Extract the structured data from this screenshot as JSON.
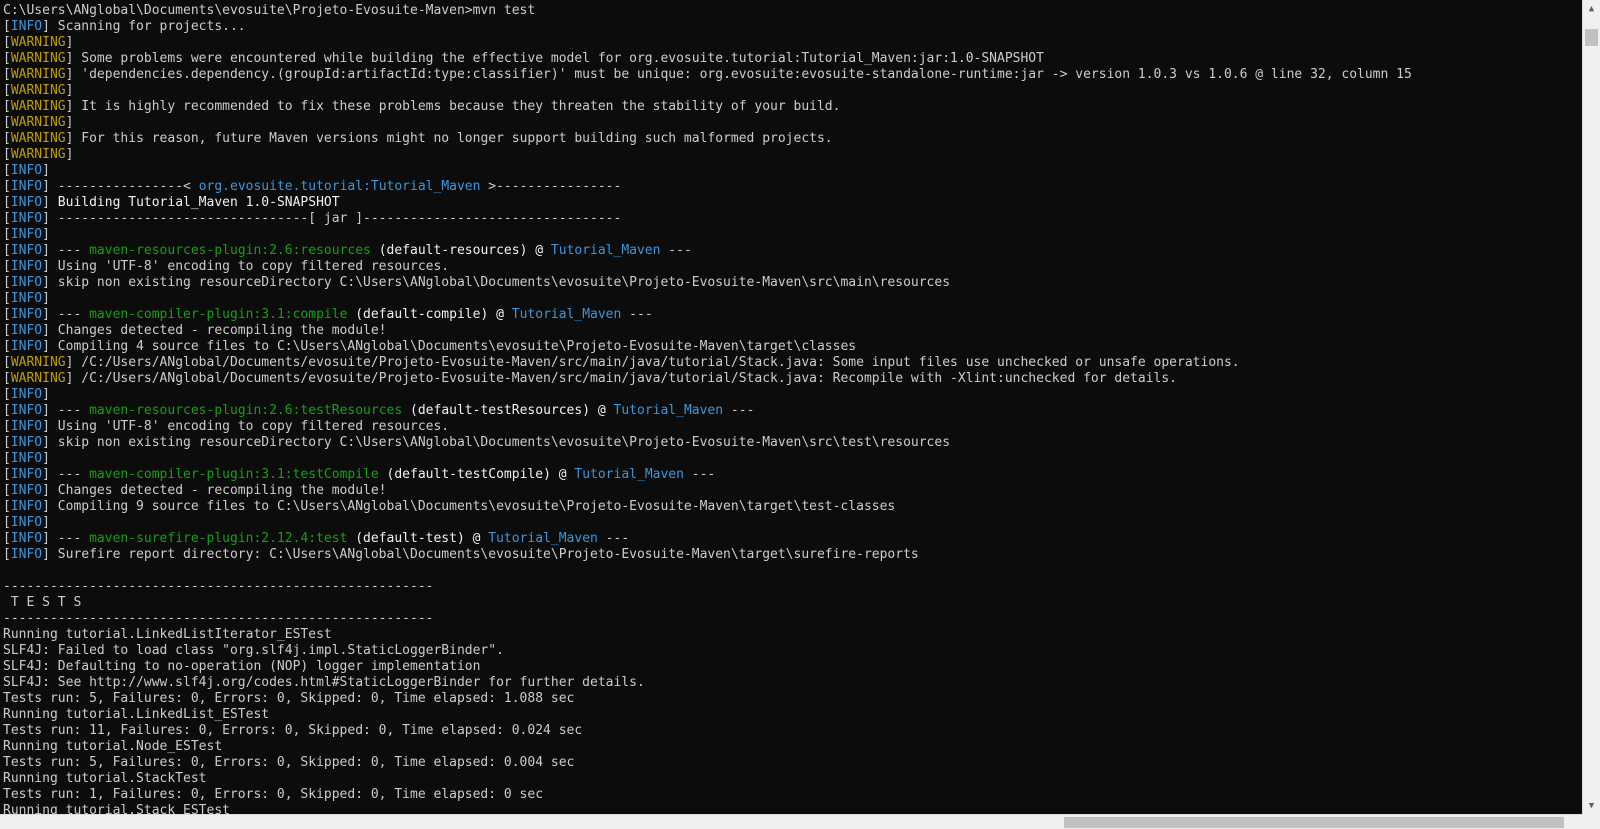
{
  "console": {
    "lines": [
      [
        [
          "C:\\Users\\ANglobal\\Documents\\evosuite\\Projeto-Evosuite-Maven>mvn test",
          "dim"
        ]
      ],
      [
        [
          "[",
          "bracket"
        ],
        [
          "INFO",
          "lvl-INFO"
        ],
        [
          "] Scanning for projects...",
          "dim"
        ]
      ],
      [
        [
          "[",
          "bracket"
        ],
        [
          "WARNING",
          "lvl-WARNING"
        ],
        [
          "]",
          "bracket"
        ]
      ],
      [
        [
          "[",
          "bracket"
        ],
        [
          "WARNING",
          "lvl-WARNING"
        ],
        [
          "] Some problems were encountered while building the effective model for org.evosuite.tutorial:Tutorial_Maven:jar:1.0-SNAPSHOT",
          "dim"
        ]
      ],
      [
        [
          "[",
          "bracket"
        ],
        [
          "WARNING",
          "lvl-WARNING"
        ],
        [
          "] 'dependencies.dependency.(groupId:artifactId:type:classifier)' must be unique: org.evosuite:evosuite-standalone-runtime:jar -> version 1.0.3 vs 1.0.6 @ line 32, column 15",
          "dim"
        ]
      ],
      [
        [
          "[",
          "bracket"
        ],
        [
          "WARNING",
          "lvl-WARNING"
        ],
        [
          "]",
          "bracket"
        ]
      ],
      [
        [
          "[",
          "bracket"
        ],
        [
          "WARNING",
          "lvl-WARNING"
        ],
        [
          "] It is highly recommended to fix these problems because they threaten the stability of your build.",
          "dim"
        ]
      ],
      [
        [
          "[",
          "bracket"
        ],
        [
          "WARNING",
          "lvl-WARNING"
        ],
        [
          "]",
          "bracket"
        ]
      ],
      [
        [
          "[",
          "bracket"
        ],
        [
          "WARNING",
          "lvl-WARNING"
        ],
        [
          "] For this reason, future Maven versions might no longer support building such malformed projects.",
          "dim"
        ]
      ],
      [
        [
          "[",
          "bracket"
        ],
        [
          "WARNING",
          "lvl-WARNING"
        ],
        [
          "]",
          "bracket"
        ]
      ],
      [
        [
          "[",
          "bracket"
        ],
        [
          "INFO",
          "lvl-INFO"
        ],
        [
          "]",
          "bracket"
        ]
      ],
      [
        [
          "[",
          "bracket"
        ],
        [
          "INFO",
          "lvl-INFO"
        ],
        [
          "] ----------------< ",
          "dim"
        ],
        [
          "org.evosuite.tutorial:Tutorial_Maven",
          "proj"
        ],
        [
          " >----------------",
          "dim"
        ]
      ],
      [
        [
          "[",
          "bracket"
        ],
        [
          "INFO",
          "lvl-INFO"
        ],
        [
          "] ",
          "dim"
        ],
        [
          "Building Tutorial_Maven 1.0-SNAPSHOT",
          "bright"
        ]
      ],
      [
        [
          "[",
          "bracket"
        ],
        [
          "INFO",
          "lvl-INFO"
        ],
        [
          "] --------------------------------[ jar ]---------------------------------",
          "dim"
        ]
      ],
      [
        [
          "[",
          "bracket"
        ],
        [
          "INFO",
          "lvl-INFO"
        ],
        [
          "]",
          "bracket"
        ]
      ],
      [
        [
          "[",
          "bracket"
        ],
        [
          "INFO",
          "lvl-INFO"
        ],
        [
          "] --- ",
          "dim"
        ],
        [
          "maven-resources-plugin:2.6:resources",
          "plugin"
        ],
        [
          " (default-resources) @ ",
          "bright"
        ],
        [
          "Tutorial_Maven",
          "proj"
        ],
        [
          " ---",
          "dim"
        ]
      ],
      [
        [
          "[",
          "bracket"
        ],
        [
          "INFO",
          "lvl-INFO"
        ],
        [
          "] Using 'UTF-8' encoding to copy filtered resources.",
          "dim"
        ]
      ],
      [
        [
          "[",
          "bracket"
        ],
        [
          "INFO",
          "lvl-INFO"
        ],
        [
          "] skip non existing resourceDirectory C:\\Users\\ANglobal\\Documents\\evosuite\\Projeto-Evosuite-Maven\\src\\main\\resources",
          "dim"
        ]
      ],
      [
        [
          "[",
          "bracket"
        ],
        [
          "INFO",
          "lvl-INFO"
        ],
        [
          "]",
          "bracket"
        ]
      ],
      [
        [
          "[",
          "bracket"
        ],
        [
          "INFO",
          "lvl-INFO"
        ],
        [
          "] --- ",
          "dim"
        ],
        [
          "maven-compiler-plugin:3.1:compile",
          "plugin"
        ],
        [
          " (default-compile) @ ",
          "bright"
        ],
        [
          "Tutorial_Maven",
          "proj"
        ],
        [
          " ---",
          "dim"
        ]
      ],
      [
        [
          "[",
          "bracket"
        ],
        [
          "INFO",
          "lvl-INFO"
        ],
        [
          "] Changes detected - recompiling the module!",
          "dim"
        ]
      ],
      [
        [
          "[",
          "bracket"
        ],
        [
          "INFO",
          "lvl-INFO"
        ],
        [
          "] Compiling 4 source files to C:\\Users\\ANglobal\\Documents\\evosuite\\Projeto-Evosuite-Maven\\target\\classes",
          "dim"
        ]
      ],
      [
        [
          "[",
          "bracket"
        ],
        [
          "WARNING",
          "lvl-WARNING"
        ],
        [
          "] /C:/Users/ANglobal/Documents/evosuite/Projeto-Evosuite-Maven/src/main/java/tutorial/Stack.java: Some input files use unchecked or unsafe operations.",
          "dim"
        ]
      ],
      [
        [
          "[",
          "bracket"
        ],
        [
          "WARNING",
          "lvl-WARNING"
        ],
        [
          "] /C:/Users/ANglobal/Documents/evosuite/Projeto-Evosuite-Maven/src/main/java/tutorial/Stack.java: Recompile with -Xlint:unchecked for details.",
          "dim"
        ]
      ],
      [
        [
          "[",
          "bracket"
        ],
        [
          "INFO",
          "lvl-INFO"
        ],
        [
          "]",
          "bracket"
        ]
      ],
      [
        [
          "[",
          "bracket"
        ],
        [
          "INFO",
          "lvl-INFO"
        ],
        [
          "] --- ",
          "dim"
        ],
        [
          "maven-resources-plugin:2.6:testResources",
          "plugin"
        ],
        [
          " (default-testResources) @ ",
          "bright"
        ],
        [
          "Tutorial_Maven",
          "proj"
        ],
        [
          " ---",
          "dim"
        ]
      ],
      [
        [
          "[",
          "bracket"
        ],
        [
          "INFO",
          "lvl-INFO"
        ],
        [
          "] Using 'UTF-8' encoding to copy filtered resources.",
          "dim"
        ]
      ],
      [
        [
          "[",
          "bracket"
        ],
        [
          "INFO",
          "lvl-INFO"
        ],
        [
          "] skip non existing resourceDirectory C:\\Users\\ANglobal\\Documents\\evosuite\\Projeto-Evosuite-Maven\\src\\test\\resources",
          "dim"
        ]
      ],
      [
        [
          "[",
          "bracket"
        ],
        [
          "INFO",
          "lvl-INFO"
        ],
        [
          "]",
          "bracket"
        ]
      ],
      [
        [
          "[",
          "bracket"
        ],
        [
          "INFO",
          "lvl-INFO"
        ],
        [
          "] --- ",
          "dim"
        ],
        [
          "maven-compiler-plugin:3.1:testCompile",
          "plugin"
        ],
        [
          " (default-testCompile) @ ",
          "bright"
        ],
        [
          "Tutorial_Maven",
          "proj"
        ],
        [
          " ---",
          "dim"
        ]
      ],
      [
        [
          "[",
          "bracket"
        ],
        [
          "INFO",
          "lvl-INFO"
        ],
        [
          "] Changes detected - recompiling the module!",
          "dim"
        ]
      ],
      [
        [
          "[",
          "bracket"
        ],
        [
          "INFO",
          "lvl-INFO"
        ],
        [
          "] Compiling 9 source files to C:\\Users\\ANglobal\\Documents\\evosuite\\Projeto-Evosuite-Maven\\target\\test-classes",
          "dim"
        ]
      ],
      [
        [
          "[",
          "bracket"
        ],
        [
          "INFO",
          "lvl-INFO"
        ],
        [
          "]",
          "bracket"
        ]
      ],
      [
        [
          "[",
          "bracket"
        ],
        [
          "INFO",
          "lvl-INFO"
        ],
        [
          "] --- ",
          "dim"
        ],
        [
          "maven-surefire-plugin:2.12.4:test",
          "plugin"
        ],
        [
          " (default-test) @ ",
          "bright"
        ],
        [
          "Tutorial_Maven",
          "proj"
        ],
        [
          " ---",
          "dim"
        ]
      ],
      [
        [
          "[",
          "bracket"
        ],
        [
          "INFO",
          "lvl-INFO"
        ],
        [
          "] Surefire report directory: C:\\Users\\ANglobal\\Documents\\evosuite\\Projeto-Evosuite-Maven\\target\\surefire-reports",
          "dim"
        ]
      ],
      [
        [
          "",
          "dim"
        ]
      ],
      [
        [
          "-------------------------------------------------------",
          "dim"
        ]
      ],
      [
        [
          " T E S T S",
          "dim"
        ]
      ],
      [
        [
          "-------------------------------------------------------",
          "dim"
        ]
      ],
      [
        [
          "Running tutorial.LinkedListIterator_ESTest",
          "dim"
        ]
      ],
      [
        [
          "SLF4J: Failed to load class \"org.slf4j.impl.StaticLoggerBinder\".",
          "dim"
        ]
      ],
      [
        [
          "SLF4J: Defaulting to no-operation (NOP) logger implementation",
          "dim"
        ]
      ],
      [
        [
          "SLF4J: See http://www.slf4j.org/codes.html#StaticLoggerBinder for further details.",
          "dim"
        ]
      ],
      [
        [
          "Tests run: 5, Failures: 0, Errors: 0, Skipped: 0, Time elapsed: 1.088 sec",
          "dim"
        ]
      ],
      [
        [
          "Running tutorial.LinkedList_ESTest",
          "dim"
        ]
      ],
      [
        [
          "Tests run: 11, Failures: 0, Errors: 0, Skipped: 0, Time elapsed: 0.024 sec",
          "dim"
        ]
      ],
      [
        [
          "Running tutorial.Node_ESTest",
          "dim"
        ]
      ],
      [
        [
          "Tests run: 5, Failures: 0, Errors: 0, Skipped: 0, Time elapsed: 0.004 sec",
          "dim"
        ]
      ],
      [
        [
          "Running tutorial.StackTest",
          "dim"
        ]
      ],
      [
        [
          "Tests run: 1, Failures: 0, Errors: 0, Skipped: 0, Time elapsed: 0 sec",
          "dim"
        ]
      ],
      [
        [
          "Running tutorial.Stack_ESTest",
          "dim"
        ]
      ]
    ]
  },
  "scrollbar": {
    "up_icon": "chevron-up-icon",
    "down_icon": "chevron-down-icon",
    "vertical_position_fraction": 0.01,
    "horizontal_position_fraction": 0.67
  }
}
